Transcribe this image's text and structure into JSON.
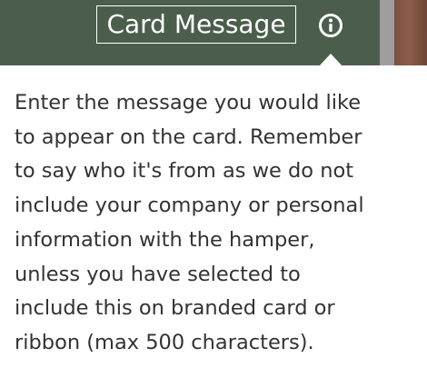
{
  "header": {
    "title": "Card Message",
    "info_icon": "info-circle-icon",
    "background_color": "#4b5e4c"
  },
  "tooltip": {
    "text": "Enter the message you would like\nto appear on the card. Remember\nto say who it's from as we do not\ninclude your company or personal\ninformation with the hamper,\nunless you have selected to\ninclude this on branded card or\nribbon (max 500 characters)."
  }
}
